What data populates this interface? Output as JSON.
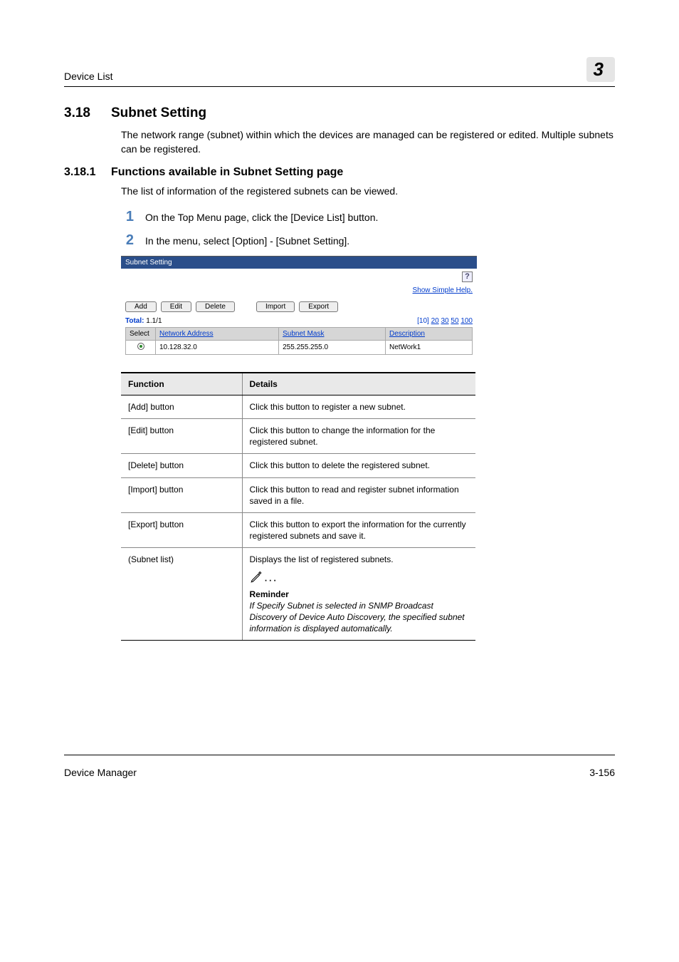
{
  "header": {
    "left": "Device List",
    "chapter": "3"
  },
  "section": {
    "num": "3.18",
    "title": "Subnet Setting",
    "intro": "The network range (subnet) within which the devices are managed can be registered or edited. Multiple subnets can be registered."
  },
  "subsection": {
    "num": "3.18.1",
    "title": "Functions available in Subnet Setting page",
    "intro": "The list of information of the registered subnets can be viewed.",
    "steps": [
      {
        "n": "1",
        "text": "On the Top Menu page, click the [Device List] button."
      },
      {
        "n": "2",
        "text": "In the menu, select [Option] - [Subnet Setting]."
      }
    ]
  },
  "shot": {
    "title": "Subnet Setting",
    "help_link": "Show Simple Help.",
    "buttons": {
      "add": "Add",
      "edit": "Edit",
      "delete": "Delete",
      "import": "Import",
      "export": "Export"
    },
    "total_label": "Total:",
    "total_value": "1.1/1",
    "pager_fixed": "[10]",
    "pager_links": [
      "20",
      "30",
      "50",
      "100"
    ],
    "cols": {
      "select": "Select",
      "addr": "Network Address",
      "mask": "Subnet Mask",
      "desc": "Description"
    },
    "row": {
      "addr": "10.128.32.0",
      "mask": "255.255.255.0",
      "desc": "NetWork1"
    }
  },
  "func_table": {
    "head_function": "Function",
    "head_details": "Details",
    "rows": [
      {
        "f": "[Add] button",
        "d": "Click this button to register a new subnet."
      },
      {
        "f": "[Edit] button",
        "d": "Click this button to change the information for the registered subnet."
      },
      {
        "f": "[Delete] button",
        "d": "Click this button to delete the registered subnet."
      },
      {
        "f": "[Import] button",
        "d": "Click this button to read and register subnet information saved in a file."
      },
      {
        "f": "[Export] button",
        "d": "Click this button to export the information for the currently registered subnets and save it."
      }
    ],
    "last": {
      "f": "(Subnet list)",
      "d": "Displays the list of registered subnets.",
      "reminder_title": "Reminder",
      "reminder_text": "If Specify Subnet is selected in SNMP Broadcast Discovery of Device Auto Discovery, the specified subnet information is displayed automatically."
    }
  },
  "footer": {
    "left": "Device Manager",
    "right": "3-156"
  }
}
